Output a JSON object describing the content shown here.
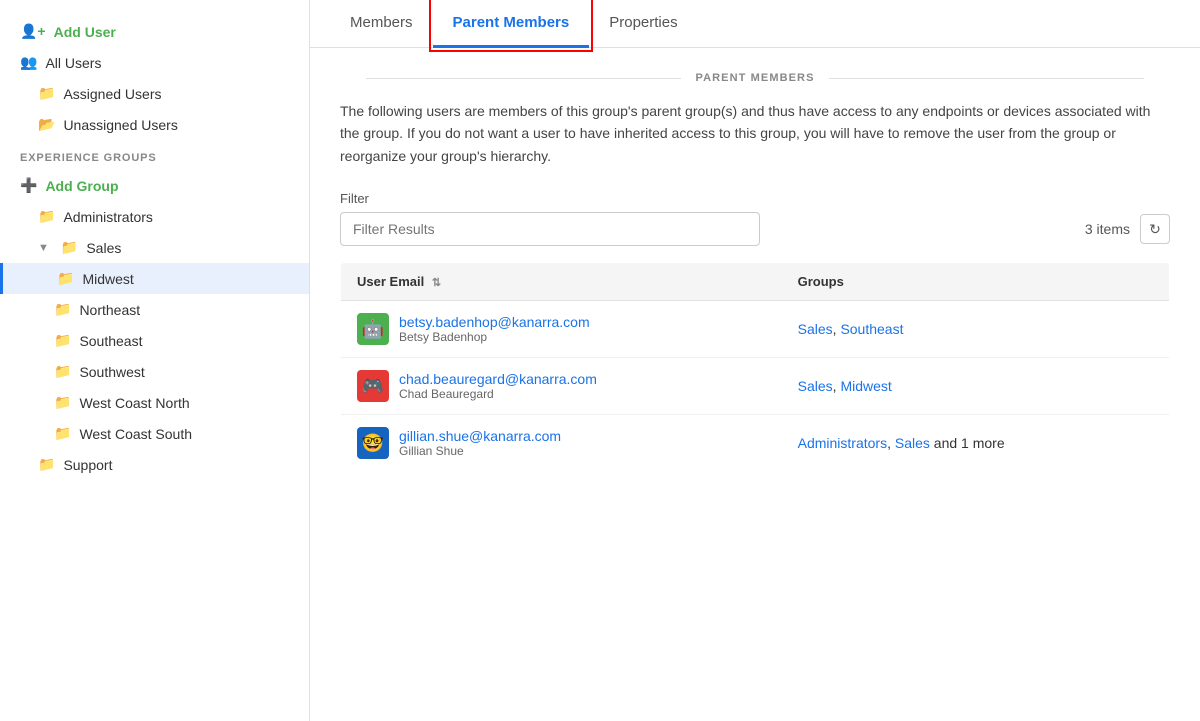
{
  "sidebar": {
    "add_user_label": "Add User",
    "all_users_label": "All Users",
    "assigned_users_label": "Assigned Users",
    "unassigned_users_label": "Unassigned Users",
    "experience_groups_label": "Experience Groups",
    "add_group_label": "Add Group",
    "groups": [
      {
        "id": "administrators",
        "label": "Administrators",
        "indent": 1,
        "expanded": false
      },
      {
        "id": "sales",
        "label": "Sales",
        "indent": 1,
        "expanded": true
      },
      {
        "id": "midwest",
        "label": "Midwest",
        "indent": 2,
        "active": true
      },
      {
        "id": "northeast",
        "label": "Northeast",
        "indent": 2
      },
      {
        "id": "southeast",
        "label": "Southeast",
        "indent": 2
      },
      {
        "id": "southwest",
        "label": "Southwest",
        "indent": 2
      },
      {
        "id": "west-coast-north",
        "label": "West Coast North",
        "indent": 2
      },
      {
        "id": "west-coast-south",
        "label": "West Coast South",
        "indent": 2
      },
      {
        "id": "support",
        "label": "Support",
        "indent": 1
      }
    ]
  },
  "tabs": [
    {
      "id": "members",
      "label": "Members",
      "active": false
    },
    {
      "id": "parent-members",
      "label": "Parent Members",
      "active": true
    },
    {
      "id": "properties",
      "label": "Properties",
      "active": false
    }
  ],
  "main": {
    "section_title": "PARENT MEMBERS",
    "description": "The following users are members of this group's parent group(s) and thus have access to any endpoints or devices associated with the group. If you do not want a user to have inherited access to this group, you will have to remove the user from the group or reorganize your group's hierarchy.",
    "filter_label": "Filter",
    "filter_placeholder": "Filter Results",
    "items_count": "3 items",
    "table": {
      "col_email": "User Email",
      "col_groups": "Groups",
      "rows": [
        {
          "email": "betsy.badenhop@kanarra.com",
          "display_name": "Betsy Badenhop",
          "avatar_emoji": "🤖",
          "avatar_bg": "#4caf50",
          "groups": [
            {
              "label": "Sales",
              "link": true
            },
            {
              "label": ", ",
              "link": false
            },
            {
              "label": "Southeast",
              "link": true
            }
          ],
          "groups_text": "Sales, Southeast"
        },
        {
          "email": "chad.beauregard@kanarra.com",
          "display_name": "Chad Beauregard",
          "avatar_emoji": "🎮",
          "avatar_bg": "#e53935",
          "groups": [
            {
              "label": "Sales",
              "link": true
            },
            {
              "label": ", ",
              "link": false
            },
            {
              "label": "Midwest",
              "link": true
            }
          ],
          "groups_text": "Sales, Midwest"
        },
        {
          "email": "gillian.shue@kanarra.com",
          "display_name": "Gillian Shue",
          "avatar_emoji": "🤓",
          "avatar_bg": "#1565c0",
          "groups": [
            {
              "label": "Administrators",
              "link": true
            },
            {
              "label": ", ",
              "link": false
            },
            {
              "label": "Sales",
              "link": true
            },
            {
              "label": " and 1 more",
              "link": false
            }
          ],
          "groups_text": "Administrators, Sales and 1 more"
        }
      ]
    }
  }
}
